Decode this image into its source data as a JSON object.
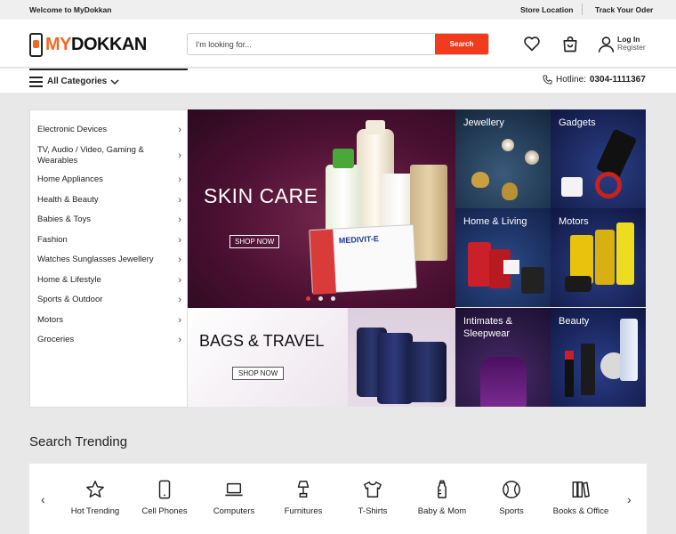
{
  "topbar": {
    "welcome": "Welcome to MyDokkan",
    "store_location": "Store Location",
    "track_order": "Track Your Oder"
  },
  "logo": {
    "part1": "MY",
    "part2": "DOKKAN"
  },
  "search": {
    "placeholder": "I'm looking for...",
    "button": "Search"
  },
  "account": {
    "login": "Log In",
    "register": "Register"
  },
  "nav": {
    "all_categories": "All Categories",
    "hotline_label": "Hotline:",
    "hotline_number": "0304-1111367"
  },
  "categories": [
    {
      "label": "Electronic Devices"
    },
    {
      "label": "TV, Audio / Video, Gaming & Wearables"
    },
    {
      "label": "Home Appliances"
    },
    {
      "label": "Health & Beauty"
    },
    {
      "label": "Babies & Toys"
    },
    {
      "label": "Fashion"
    },
    {
      "label": "Watches Sunglasses Jewellery"
    },
    {
      "label": "Home & Lifestyle"
    },
    {
      "label": "Sports & Outdoor"
    },
    {
      "label": "Motors"
    },
    {
      "label": "Groceries"
    }
  ],
  "hero": {
    "title": "SKIN CARE",
    "cta": "SHOP NOW",
    "product_label": "MEDIVIT-E"
  },
  "banner2": {
    "title": "BAGS & TRAVEL",
    "cta": "SHOP NOW"
  },
  "tiles": [
    {
      "label": "Jewellery"
    },
    {
      "label": "Gadgets"
    },
    {
      "label": "Home & Living"
    },
    {
      "label": "Motors"
    },
    {
      "label": "Intimates & Sleepwear"
    },
    {
      "label": "Beauty"
    }
  ],
  "trending": {
    "title": "Search Trending",
    "items": [
      {
        "label": "Hot Trending",
        "icon": "star-icon"
      },
      {
        "label": "Cell Phones",
        "icon": "phone-icon"
      },
      {
        "label": "Computers",
        "icon": "laptop-icon"
      },
      {
        "label": "Furnitures",
        "icon": "lamp-icon"
      },
      {
        "label": "T-Shirts",
        "icon": "tshirt-icon"
      },
      {
        "label": "Baby & Mom",
        "icon": "baby-bottle-icon"
      },
      {
        "label": "Sports",
        "icon": "ball-icon"
      },
      {
        "label": "Books & Office",
        "icon": "books-icon"
      }
    ]
  },
  "colors": {
    "accent": "#f26a21",
    "search_button": "#f23b1d"
  }
}
